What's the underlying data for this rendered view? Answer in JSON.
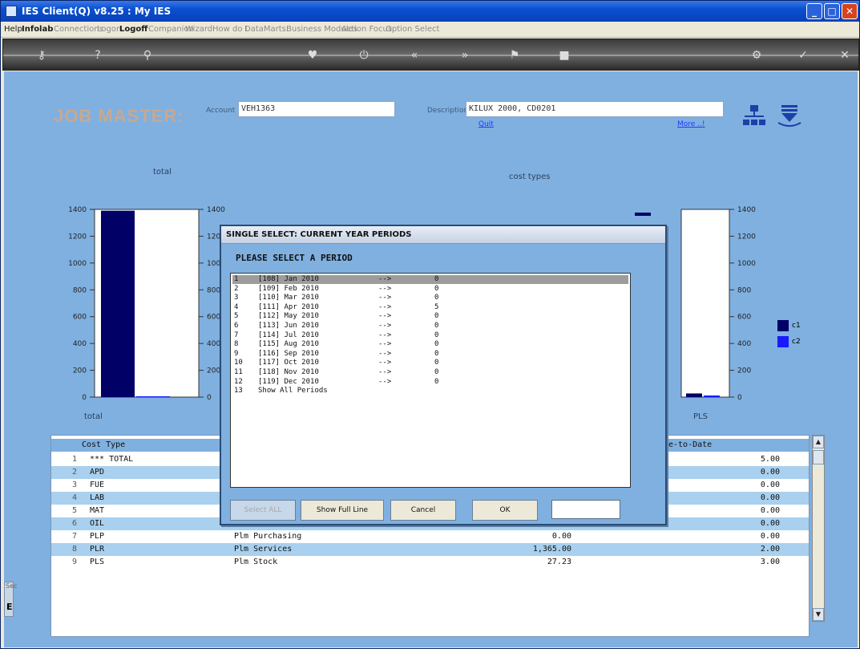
{
  "window": {
    "title": "IES Client(Q) v8.25 : My IES"
  },
  "menubar": [
    {
      "label": "Help",
      "style": "normal"
    },
    {
      "label": "Infolab",
      "style": "bold"
    },
    {
      "label": "Connections",
      "style": "dim"
    },
    {
      "label": "Logon",
      "style": "dim"
    },
    {
      "label": "Logoff",
      "style": "bold"
    },
    {
      "label": "Companion",
      "style": "dim"
    },
    {
      "label": "Wizard",
      "style": "dim"
    },
    {
      "label": "How do I",
      "style": "dim"
    },
    {
      "label": "DataMarts",
      "style": "dim"
    },
    {
      "label": "Business Modules",
      "style": "dim"
    },
    {
      "label": "Action Focus",
      "style": "dim"
    },
    {
      "label": "Option Select",
      "style": "dim"
    }
  ],
  "header": {
    "title": "JOB MASTER:",
    "account_label": "Account",
    "account_value": "VEH1363",
    "description_label": "Description",
    "description_value": "KILUX 2000, CD0201",
    "quit_link": "Quit",
    "more_link": "More ..!"
  },
  "charts": {
    "left_title": "total",
    "right_title": "cost types",
    "left_xlabel": "total",
    "right_xlabel": "PLS",
    "legend": [
      {
        "name": "c1",
        "color": "#000066"
      },
      {
        "name": "c2",
        "color": "#1a1aff"
      }
    ]
  },
  "chart_data": [
    {
      "type": "bar",
      "title": "total",
      "categories": [
        "total"
      ],
      "series": [
        {
          "name": "c1",
          "values": [
            1390
          ]
        },
        {
          "name": "c2",
          "values": [
            5
          ]
        }
      ],
      "ylim": [
        0,
        1400
      ],
      "yticks": [
        "0",
        "200",
        "400",
        "600",
        "800",
        "1000",
        "1200",
        "1400"
      ]
    },
    {
      "type": "bar",
      "title": "cost types",
      "categories": [
        "PLS"
      ],
      "series": [
        {
          "name": "c1",
          "values": [
            27.23
          ]
        },
        {
          "name": "c2",
          "values": [
            3
          ]
        }
      ],
      "ylim": [
        0,
        1400
      ],
      "yticks": [
        "0",
        "200",
        "400",
        "600",
        "800",
        "1000",
        "1200",
        "1400"
      ]
    }
  ],
  "grid": {
    "header_left": "Cost Type",
    "header_right": "e-to-Date",
    "rows": [
      {
        "num": "1",
        "code": "*** TOTAL",
        "desc": "",
        "amount": "",
        "ytd": "5.00"
      },
      {
        "num": "2",
        "code": "APD",
        "desc": "",
        "amount": "",
        "ytd": "0.00"
      },
      {
        "num": "3",
        "code": "FUE",
        "desc": "",
        "amount": "",
        "ytd": "0.00"
      },
      {
        "num": "4",
        "code": "LAB",
        "desc": "",
        "amount": "",
        "ytd": "0.00"
      },
      {
        "num": "5",
        "code": "MAT",
        "desc": "",
        "amount": "",
        "ytd": "0.00"
      },
      {
        "num": "6",
        "code": "OIL",
        "desc": "Oil",
        "amount": "0.00",
        "ytd": "0.00"
      },
      {
        "num": "7",
        "code": "PLP",
        "desc": "Plm Purchasing",
        "amount": "0.00",
        "ytd": "0.00"
      },
      {
        "num": "8",
        "code": "PLR",
        "desc": "Plm Services",
        "amount": "1,365.00",
        "ytd": "2.00"
      },
      {
        "num": "9",
        "code": "PLS",
        "desc": "Plm Stock",
        "amount": "27.23",
        "ytd": "3.00"
      }
    ]
  },
  "dialog": {
    "title": "SINGLE SELECT: CURRENT YEAR PERIODS",
    "prompt": "PLEASE SELECT A PERIOD",
    "items": [
      {
        "num": "1",
        "period": "[108] Jan 2010",
        "arrow": "-->",
        "count": "0"
      },
      {
        "num": "2",
        "period": "[109] Feb 2010",
        "arrow": "-->",
        "count": "0"
      },
      {
        "num": "3",
        "period": "[110] Mar 2010",
        "arrow": "-->",
        "count": "0"
      },
      {
        "num": "4",
        "period": "[111] Apr 2010",
        "arrow": "-->",
        "count": "5"
      },
      {
        "num": "5",
        "period": "[112] May 2010",
        "arrow": "-->",
        "count": "0"
      },
      {
        "num": "6",
        "period": "[113] Jun 2010",
        "arrow": "-->",
        "count": "0"
      },
      {
        "num": "7",
        "period": "[114] Jul 2010",
        "arrow": "-->",
        "count": "0"
      },
      {
        "num": "8",
        "period": "[115] Aug 2010",
        "arrow": "-->",
        "count": "0"
      },
      {
        "num": "9",
        "period": "[116] Sep 2010",
        "arrow": "-->",
        "count": "0"
      },
      {
        "num": "10",
        "period": "[117] Oct 2010",
        "arrow": "-->",
        "count": "0"
      },
      {
        "num": "11",
        "period": "[118] Nov 2010",
        "arrow": "-->",
        "count": "0"
      },
      {
        "num": "12",
        "period": "[119] Dec 2010",
        "arrow": "-->",
        "count": "0"
      },
      {
        "num": "13",
        "period": "Show All Periods",
        "arrow": "",
        "count": ""
      }
    ],
    "buttons": {
      "select_all": "Select ALL",
      "show_full_line": "Show Full Line",
      "cancel": "Cancel",
      "ok": "OK"
    }
  },
  "side_tab": {
    "label_top": "Sec",
    "label_bottom": "E"
  }
}
